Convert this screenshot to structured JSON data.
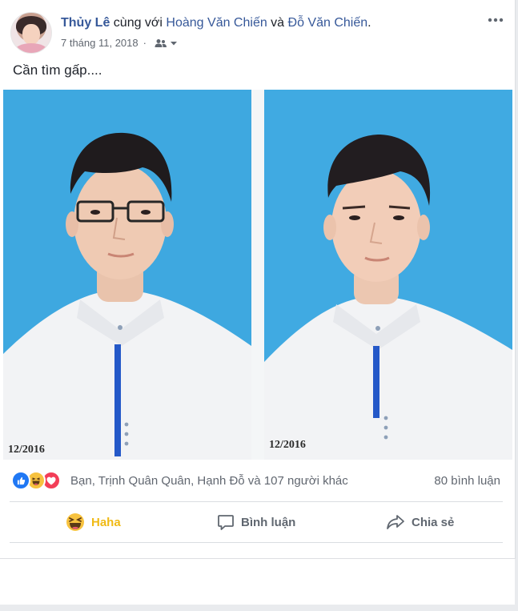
{
  "post": {
    "author": "Thủy Lê",
    "with_text": " cùng với ",
    "tagged_1": "Hoàng Văn Chiến",
    "and_text": " và ",
    "tagged_2": "Đỗ Văn Chiến",
    "end_dot": ".",
    "timestamp": "7 tháng 11, 2018",
    "text": "Cần tìm gấp....",
    "photo_date_left": "12/2016",
    "photo_date_right": "12/2016"
  },
  "reactions": {
    "icons": [
      "like-icon",
      "haha-icon",
      "love-icon"
    ],
    "summary": "Bạn, Trịnh Quân Quân, Hạnh Đỗ và 107 người khác",
    "comments": "80 bình luận"
  },
  "actions": {
    "haha": "Haha",
    "comment": "Bình luận",
    "share": "Chia sẻ"
  },
  "colors": {
    "link": "#365899",
    "haha_active": "#f0ba15",
    "like_blue": "#2078f4",
    "love_red": "#f33e58",
    "photo_bg": "#3ea8e0"
  }
}
